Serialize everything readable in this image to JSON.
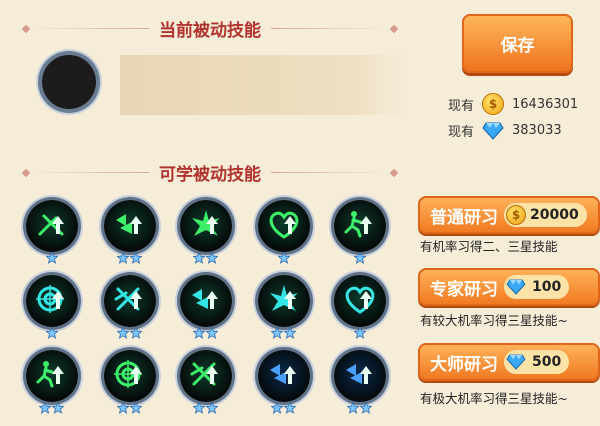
{
  "current_section": {
    "title": "当前被动技能"
  },
  "learnable_section": {
    "title": "可学被动技能"
  },
  "save_button": {
    "label": "保存"
  },
  "currency": {
    "gold": {
      "label": "现有",
      "value": "16436301",
      "icon": "gold-coin-icon"
    },
    "diamond": {
      "label": "现有",
      "value": "383033",
      "icon": "diamond-icon"
    }
  },
  "study_options": [
    {
      "title": "普通研习",
      "cost": "20000",
      "cost_icon": "gold-coin-icon",
      "desc": "有机率习得二、三星技能"
    },
    {
      "title": "专家研习",
      "cost": "100",
      "cost_icon": "diamond-icon",
      "desc": "有较大机率习得三星技能~"
    },
    {
      "title": "大师研习",
      "cost": "500",
      "cost_icon": "diamond-icon",
      "desc": "有极大机率习得三星技能~"
    }
  ],
  "skills": [
    {
      "icon": "crossed-arrows-up-icon",
      "stars": 1
    },
    {
      "icon": "double-arrow-up-icon",
      "stars": 2
    },
    {
      "icon": "burst-up-icon",
      "stars": 2
    },
    {
      "icon": "heart-up-icon",
      "stars": 1
    },
    {
      "icon": "running-man-up-icon",
      "stars": 1
    },
    {
      "icon": "target-up-icon",
      "stars": 1
    },
    {
      "icon": "cross-swords-up-icon",
      "stars": 2
    },
    {
      "icon": "double-arrow-up-icon",
      "stars": 2
    },
    {
      "icon": "burst-up-icon",
      "stars": 2
    },
    {
      "icon": "heart-up-icon",
      "stars": 1
    },
    {
      "icon": "running-man-up-icon",
      "stars": 2
    },
    {
      "icon": "target-up-icon",
      "stars": 2
    },
    {
      "icon": "cross-swords-up-icon",
      "stars": 2
    },
    {
      "icon": "double-arrow-up-icon",
      "stars": 2
    },
    {
      "icon": "double-arrow-up-icon",
      "stars": 2
    }
  ],
  "colors": {
    "accent_red": "#b1332e",
    "button_orange": "#f07a22",
    "skill_green": "#3cf06a",
    "skill_cyan": "#34e6e6",
    "skill_blue": "#4aa0ff"
  }
}
